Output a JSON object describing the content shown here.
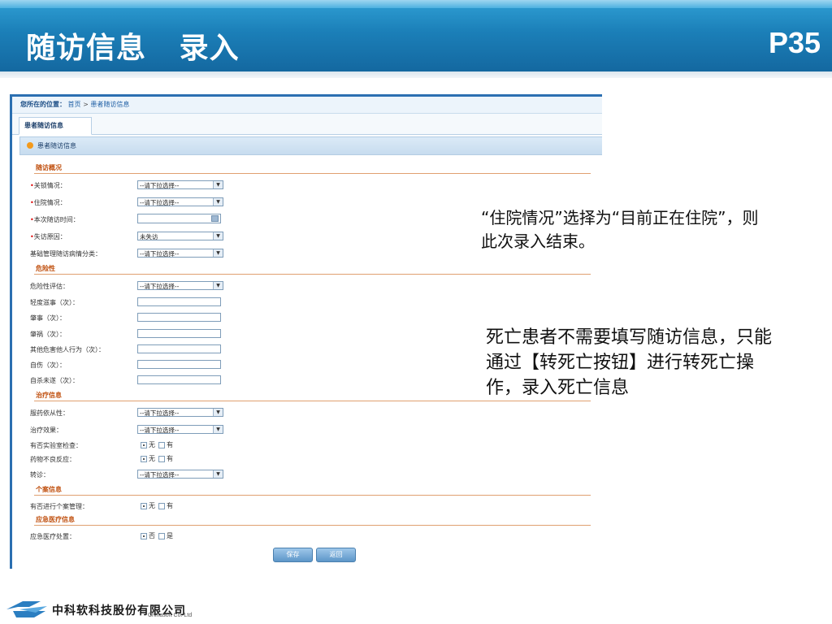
{
  "slide": {
    "title": "随访信息   录入",
    "page_number": "P35"
  },
  "app": {
    "breadcrumb_label": "您所在的位置：",
    "breadcrumb_home": "首页",
    "breadcrumb_sep": " > ",
    "breadcrumb_current": "患者随访信息",
    "tab_label": "患者随访信息",
    "panel_title": "患者随访信息"
  },
  "sections": {
    "visit_overview": "随访概况",
    "risk": "危险性",
    "treatment": "治疗信息",
    "case": "个案信息",
    "emergency": "应急医疗信息"
  },
  "fields": {
    "lock_status": {
      "label": "关锁情况：",
      "value": "--请下拉选择--"
    },
    "hospital_status": {
      "label": "住院情况：",
      "value": "--请下拉选择--"
    },
    "visit_time": {
      "label": "本次随访时间：",
      "value": ""
    },
    "miss_reason": {
      "label": "失访原因：",
      "value": "未失访"
    },
    "basic_mgmt": {
      "label": "基础管理随访病情分类：",
      "value": "--请下拉选择--"
    },
    "risk_assess": {
      "label": "危险性评估：",
      "value": "--请下拉选择--"
    },
    "minor_trouble": {
      "label": "轻度滋事（次）：",
      "value": ""
    },
    "trouble": {
      "label": "肇事（次）：",
      "value": ""
    },
    "disaster": {
      "label": "肇祸（次）：",
      "value": ""
    },
    "harm_others": {
      "label": "其他危害他人行为（次）：",
      "value": ""
    },
    "self_harm": {
      "label": "自伤（次）：",
      "value": ""
    },
    "suicide_attempt": {
      "label": "自杀未遂（次）：",
      "value": ""
    },
    "compliance": {
      "label": "服药依从性：",
      "value": "--请下拉选择--"
    },
    "effect": {
      "label": "治疗效果：",
      "value": "--请下拉选择--"
    },
    "lab_check": {
      "label": "有否实验室检查：",
      "opt1": "无",
      "opt2": "有"
    },
    "adverse": {
      "label": "药物不良反应：",
      "opt1": "无",
      "opt2": "有"
    },
    "referral": {
      "label": "转诊：",
      "value": "--请下拉选择--"
    },
    "case_mgmt": {
      "label": "有否进行个案管理：",
      "opt1": "无",
      "opt2": "有"
    },
    "emergency_care": {
      "label": "应急医疗处置：",
      "opt1": "否",
      "opt2": "是"
    }
  },
  "buttons": {
    "save": "保存",
    "back": "返回"
  },
  "notes": {
    "note1": "“住院情况”选择为“目前正在住院”，则此次录入结束。",
    "note2": "死亡患者不需要填写随访信息，只能通过【转死亡按钮】进行转死亡操作，录入死亡信息"
  },
  "footer": {
    "company_cn": "中科软科技股份有限公司",
    "company_en": "Chinasoft Co. Ltd"
  },
  "colors": {
    "header_blue": "#1b7fb8",
    "section_orange": "#c0500f",
    "required_red": "#dd0000"
  }
}
